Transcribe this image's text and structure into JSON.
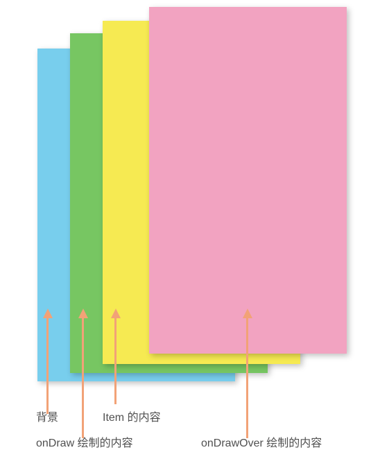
{
  "layers": [
    {
      "id": "bg",
      "label": "背景",
      "color": "#78ceed"
    },
    {
      "id": "ondraw",
      "label": "onDraw 绘制的内容",
      "color": "#77c662"
    },
    {
      "id": "item",
      "label": "Item 的内容",
      "color": "#f6ea52"
    },
    {
      "id": "ondrawover",
      "label": "onDrawOver 绘制的内容",
      "color": "#f2a3c1"
    }
  ]
}
